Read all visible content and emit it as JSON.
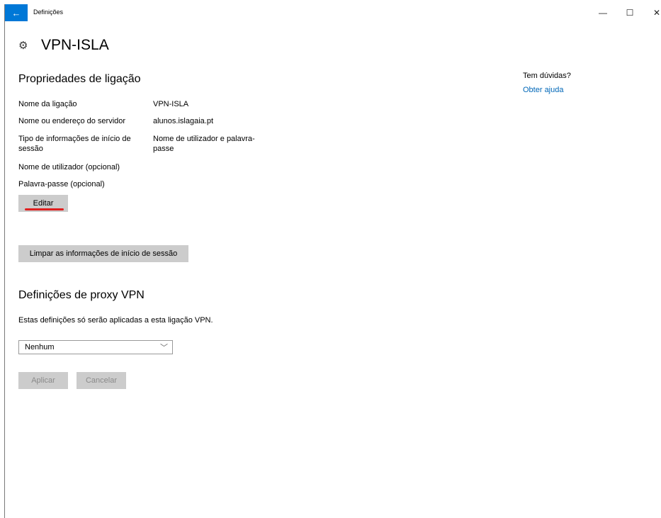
{
  "titlebar": {
    "back_icon": "←",
    "title": "Definições",
    "min_icon": "—",
    "max_icon": "☐",
    "close_icon": "✕"
  },
  "header": {
    "gear_icon": "⚙",
    "title": "VPN-ISLA"
  },
  "connection": {
    "section_title": "Propriedades de ligação",
    "properties": [
      {
        "label": "Nome da ligação",
        "value": "VPN-ISLA"
      },
      {
        "label": "Nome ou endereço do servidor",
        "value": "alunos.islagaia.pt"
      },
      {
        "label": "Tipo de informações de início de sessão",
        "value": "Nome de utilizador e palavra-passe"
      },
      {
        "label": "Nome de utilizador (opcional)",
        "value": ""
      },
      {
        "label": "Palavra-passe (opcional)",
        "value": ""
      }
    ],
    "edit_label": "Editar",
    "clear_label": "Limpar as informações de início de sessão"
  },
  "proxy": {
    "section_title": "Definições de proxy VPN",
    "description": "Estas definições só serão aplicadas a esta ligação VPN.",
    "selected": "Nenhum",
    "chevron_icon": "﹀",
    "apply_label": "Aplicar",
    "cancel_label": "Cancelar"
  },
  "help": {
    "title": "Tem dúvidas?",
    "link": "Obter ajuda"
  }
}
